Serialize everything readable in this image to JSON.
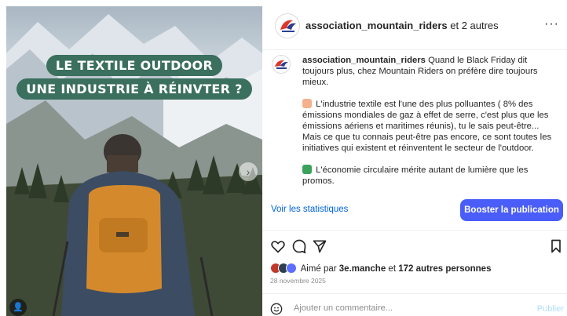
{
  "media": {
    "headline_line1": "LE TEXTILE OUTDOOR",
    "headline_line2": "UNE INDUSTRIE À RÉINVTER ?",
    "next_icon": "chevron-right-icon",
    "tag_icon": "user-tag-icon",
    "colors": {
      "headline_bg": "#3b6f5e",
      "backpack": "#d48a2c",
      "jacket": "#3b4c63"
    }
  },
  "header": {
    "username": "association_mountain_riders",
    "suffix": " et 2 autres",
    "more_icon": "more-horizontal-icon",
    "more_label": "···"
  },
  "caption": {
    "username": "association_mountain_riders",
    "intro": " Quand le Black Friday dit toujours plus, chez Mountain Riders on préfère dire toujours mieux.",
    "para2_emoji": "hand-pointing-icon",
    "para2": "L'industrie textile est l'une des plus polluantes ( 8% des émissions mondiales de gaz à effet de serre, c'est plus que les émissions aériens et maritimes réunis), tu le sais peut-être... Mais ce que tu connais peut-être pas encore, ce sont toutes les initiatives qui existent et réinventent le secteur de l'outdoor.",
    "para3_emoji": "recycle-icon",
    "para3": "L'économie circulaire mérite autant de lumière que les promos."
  },
  "stats_link": "Voir les statistiques",
  "boost_button": "Booster la publication",
  "actions": {
    "like_icon": "heart-icon",
    "comment_icon": "comment-icon",
    "share_icon": "send-icon",
    "save_icon": "bookmark-icon"
  },
  "likes": {
    "prefix": "Aimé par ",
    "user": "3e.manche",
    "middle": " et ",
    "others": "172 autres personnes"
  },
  "date": "28 novembre 2025",
  "comment": {
    "placeholder": "Ajouter un commentaire...",
    "publish": "Publier",
    "emoji_icon": "smiley-icon"
  },
  "brand_color": "#4a5df9",
  "link_color": "#0064e0"
}
